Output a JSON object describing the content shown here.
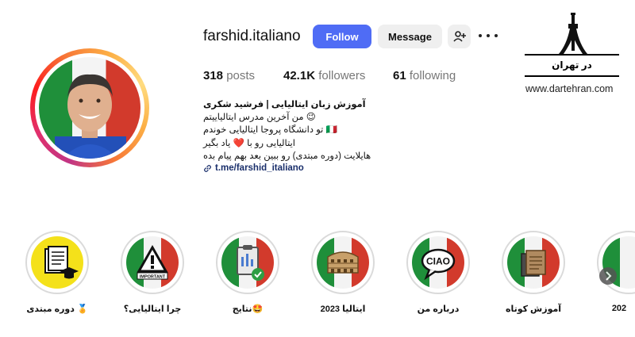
{
  "profile": {
    "username": "farshid.italiano",
    "buttons": {
      "follow": "Follow",
      "message": "Message"
    },
    "stats": {
      "posts_value": "318",
      "posts_label": "posts",
      "followers_value": "42.1K",
      "followers_label": "followers",
      "following_value": "61",
      "following_label": "following"
    },
    "bio": {
      "name": "آموزش زبان ایتالیایی | فرشید شکری",
      "line1": "😉 من آخرین مدرس ایتالیاییتم",
      "line2": "🇮🇹 تو دانشگاه پروجا ایتالیایی خوندم",
      "line3": "ایتالیایی رو با ❤️ یاد بگیر",
      "line4": "هایلایت (دوره مبتدی) رو ببین بعد بهم پیام بده",
      "link": "t.me/farshid_italiano"
    }
  },
  "watermark": {
    "brand": "در تهران",
    "url": "www.dartehran.com"
  },
  "highlights": [
    {
      "label": "دوره مبتدی 🏅",
      "icon": "course-book-icon",
      "style": "yellow"
    },
    {
      "label": "چرا ایتالیایی؟",
      "icon": "important-warning-icon",
      "style": "flag",
      "badge": "IMPORTANT"
    },
    {
      "label": "نتایج🤩",
      "icon": "results-clipboard-icon",
      "style": "flag"
    },
    {
      "label": "ایتالیا 2023",
      "icon": "colosseum-icon",
      "style": "flag"
    },
    {
      "label": "درباره من",
      "icon": "ciao-speech-bubble-icon",
      "style": "flag",
      "badge": "CIAO"
    },
    {
      "label": "آموزش کوتاه",
      "icon": "notebook-icon",
      "style": "flag"
    },
    {
      "label": "202",
      "icon": "flag-icon",
      "style": "flag"
    }
  ],
  "colors": {
    "follow_button": "#4f6cf5",
    "secondary_button": "#efefef",
    "link": "#1a2f6b",
    "highlight_yellow": "#f4e11a"
  }
}
